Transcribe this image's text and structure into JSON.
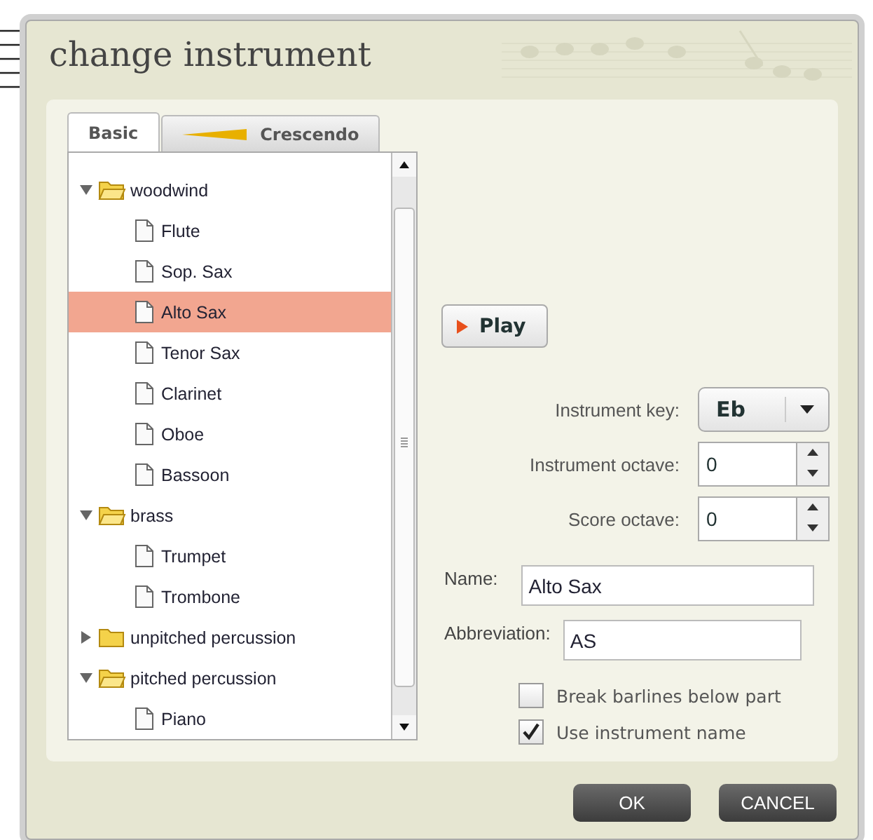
{
  "dialog": {
    "title": "change instrument"
  },
  "tabs": [
    {
      "label": "Basic",
      "selected": true,
      "kind": "text"
    },
    {
      "label": "Crescendo",
      "selected": false,
      "kind": "crescendo"
    }
  ],
  "tree": [
    {
      "label": "woodwind",
      "expanded": true,
      "children": [
        {
          "label": "Flute",
          "selected": false
        },
        {
          "label": "Sop. Sax",
          "selected": false
        },
        {
          "label": "Alto Sax",
          "selected": true
        },
        {
          "label": "Tenor Sax",
          "selected": false
        },
        {
          "label": "Clarinet",
          "selected": false
        },
        {
          "label": "Oboe",
          "selected": false
        },
        {
          "label": "Bassoon",
          "selected": false
        }
      ]
    },
    {
      "label": "brass",
      "expanded": true,
      "children": [
        {
          "label": "Trumpet",
          "selected": false
        },
        {
          "label": "Trombone",
          "selected": false
        }
      ]
    },
    {
      "label": "unpitched percussion",
      "expanded": false
    },
    {
      "label": "pitched percussion",
      "expanded": true,
      "children": [
        {
          "label": "Piano",
          "selected": false
        }
      ]
    }
  ],
  "play_button": "Play",
  "instrument_key": {
    "label": "Instrument key:",
    "value": "Eb"
  },
  "instrument_octave": {
    "label": "Instrument octave:",
    "value": "0"
  },
  "score_octave": {
    "label": "Score octave:",
    "value": "0"
  },
  "name": {
    "label": "Name:",
    "value": "Alto Sax"
  },
  "abbreviation": {
    "label": "Abbreviation:",
    "value": "AS"
  },
  "options": [
    {
      "label": "Break barlines below part",
      "checked": false
    },
    {
      "label": "Use instrument name",
      "checked": true
    }
  ],
  "buttons": [
    "OK",
    "CANCEL"
  ]
}
